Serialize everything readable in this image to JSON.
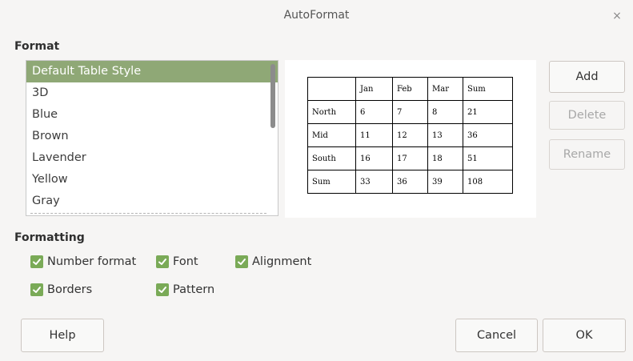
{
  "window": {
    "title": "AutoFormat",
    "close_glyph": "×"
  },
  "format_section": {
    "label": "Format",
    "styles": [
      "Default Table Style",
      "3D",
      "Blue",
      "Brown",
      "Lavender",
      "Yellow",
      "Gray"
    ],
    "selected": "Default Table Style"
  },
  "preview": {
    "rows": [
      [
        "",
        "Jan",
        "Feb",
        "Mar",
        "Sum"
      ],
      [
        "North",
        "6",
        "7",
        "8",
        "21"
      ],
      [
        "Mid",
        "11",
        "12",
        "13",
        "36"
      ],
      [
        "South",
        "16",
        "17",
        "18",
        "51"
      ],
      [
        "Sum",
        "33",
        "36",
        "39",
        "108"
      ]
    ]
  },
  "side_buttons": {
    "add": "Add",
    "delete": "Delete",
    "rename": "Rename"
  },
  "formatting_section": {
    "label": "Formatting",
    "options": {
      "number_format": "Number format",
      "font": "Font",
      "alignment": "Alignment",
      "borders": "Borders",
      "pattern": "Pattern"
    },
    "checked": true
  },
  "footer": {
    "help": "Help",
    "cancel": "Cancel",
    "ok": "OK"
  },
  "colors": {
    "accent": "#8fa876",
    "checkbox": "#7aaa57",
    "background": "#f6f5f4"
  }
}
